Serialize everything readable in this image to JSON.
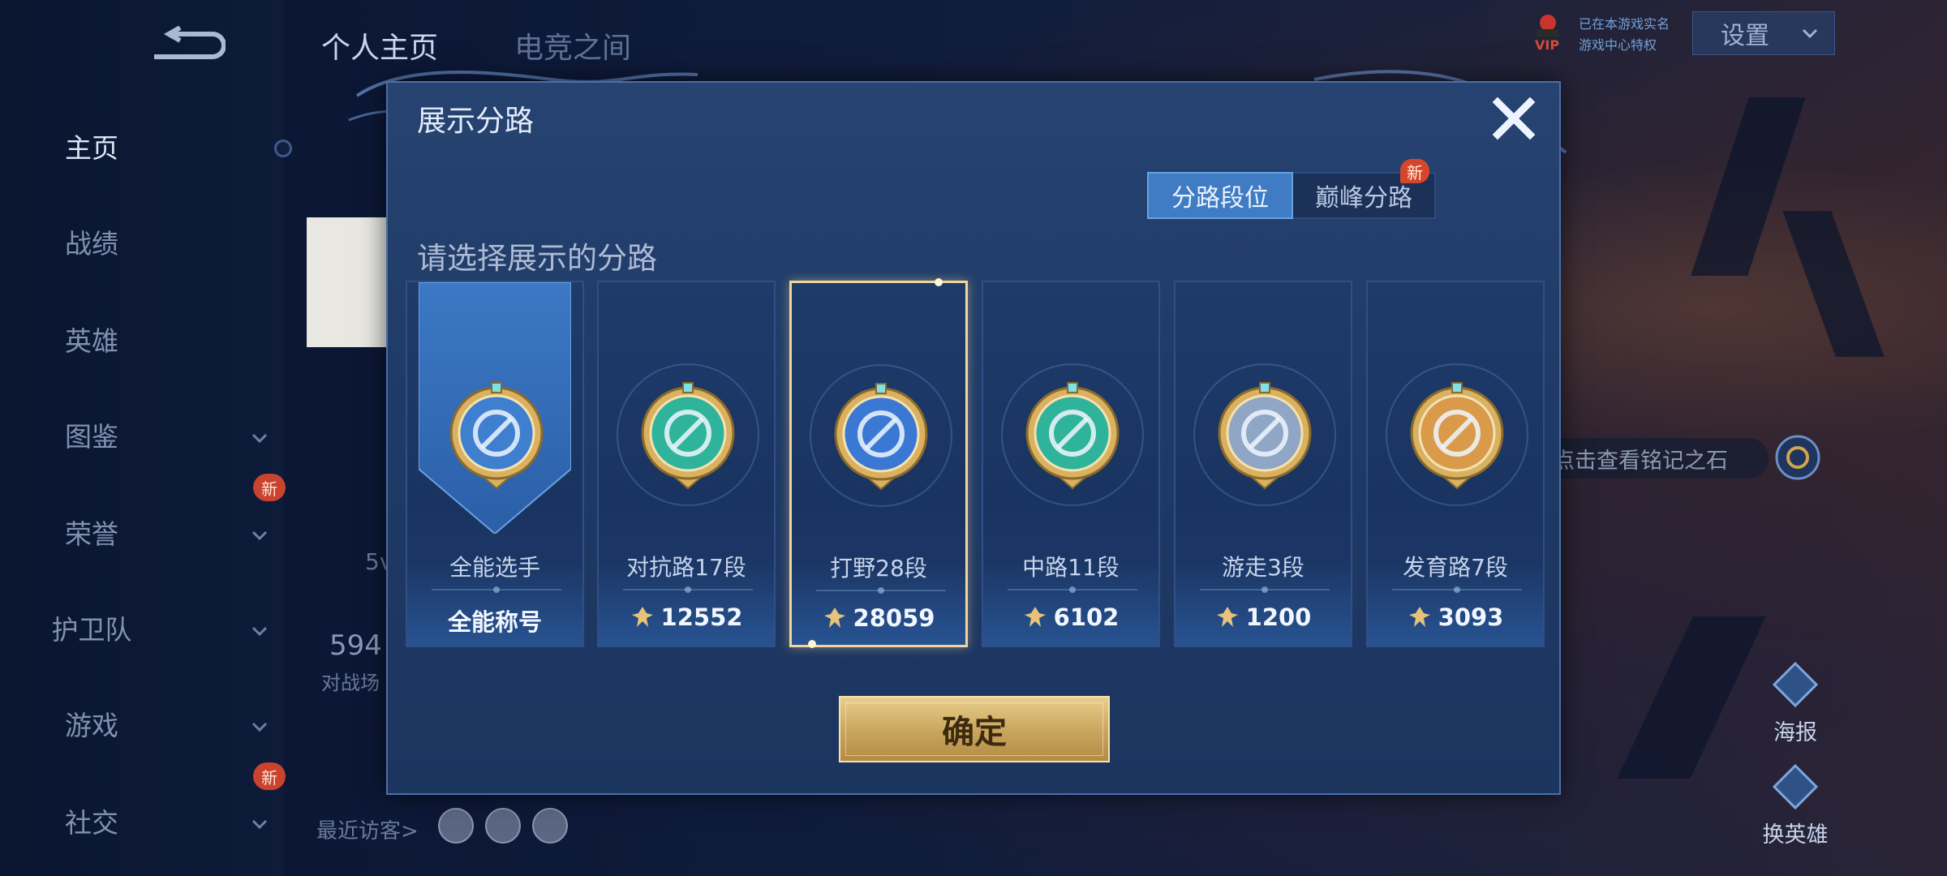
{
  "background": {
    "top_tabs": [
      "个人主页",
      "电竞之间"
    ],
    "nav": [
      {
        "label": "主页",
        "active": true,
        "chevron": false,
        "new": false
      },
      {
        "label": "战绩",
        "active": false,
        "chevron": false,
        "new": false
      },
      {
        "label": "英雄",
        "active": false,
        "chevron": false,
        "new": false
      },
      {
        "label": "图鉴",
        "active": false,
        "chevron": true,
        "new": false
      },
      {
        "label": "荣誉",
        "active": false,
        "chevron": true,
        "new": true
      },
      {
        "label": "护卫队",
        "active": false,
        "chevron": true,
        "new": false
      },
      {
        "label": "游戏",
        "active": false,
        "chevron": true,
        "new": false
      },
      {
        "label": "社交",
        "active": false,
        "chevron": true,
        "new": true
      }
    ],
    "new_badge": "新",
    "settings_label": "设置",
    "vip_label": "VIP",
    "vip_line1": "已在本游戏实名",
    "vip_line2": "游戏中心特权",
    "rune_hint": "点击查看铭记之石",
    "poster_label": "海报",
    "switch_hero_label": "换英雄",
    "recent_visitors_label": "最近访客>",
    "partial_5v": "5v",
    "partial_num": "594",
    "partial_sub": "对战场"
  },
  "modal": {
    "title": "展示分路",
    "tabs": [
      {
        "label": "分路段位",
        "active": true
      },
      {
        "label": "巅峰分路",
        "active": false,
        "badge": "新"
      }
    ],
    "prompt": "请选择展示的分路",
    "cards": [
      {
        "name": "全能选手",
        "score": "全能称号",
        "has_icon": false,
        "selected": false,
        "emblem": "allround-emblem-icon",
        "color": "#3f7fd0"
      },
      {
        "name": "对抗路17段",
        "score": "12552",
        "has_icon": true,
        "selected": false,
        "emblem": "clash-lane-emblem-icon",
        "color": "#2fb39a"
      },
      {
        "name": "打野28段",
        "score": "28059",
        "has_icon": true,
        "selected": true,
        "emblem": "jungle-emblem-icon",
        "color": "#3a78d4"
      },
      {
        "name": "中路11段",
        "score": "6102",
        "has_icon": true,
        "selected": false,
        "emblem": "mid-lane-emblem-icon",
        "color": "#2fb39a"
      },
      {
        "name": "游走3段",
        "score": "1200",
        "has_icon": true,
        "selected": false,
        "emblem": "roam-emblem-icon",
        "color": "#8fa6c4"
      },
      {
        "name": "发育路7段",
        "score": "3093",
        "has_icon": true,
        "selected": false,
        "emblem": "farm-lane-emblem-icon",
        "color": "#d99a4a"
      }
    ],
    "confirm_label": "确定"
  }
}
